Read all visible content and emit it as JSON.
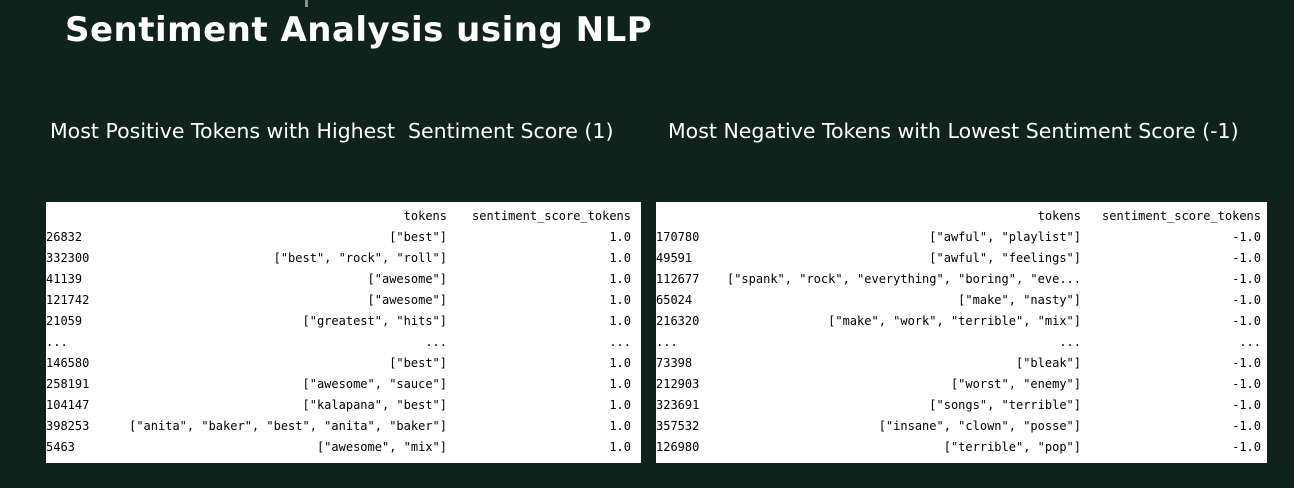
{
  "title": "Sentiment Analysis using NLP",
  "positive_panel": {
    "heading": "Most Positive Tokens with Highest  Sentiment Score (1)",
    "columns": [
      "tokens",
      "sentiment_score_tokens"
    ],
    "rows": [
      {
        "index": "26832",
        "tokens": "[\"best\"]",
        "score": "1.0"
      },
      {
        "index": "332300",
        "tokens": "[\"best\", \"rock\", \"roll\"]",
        "score": "1.0"
      },
      {
        "index": "41139",
        "tokens": "[\"awesome\"]",
        "score": "1.0"
      },
      {
        "index": "121742",
        "tokens": "[\"awesome\"]",
        "score": "1.0"
      },
      {
        "index": "21059",
        "tokens": "[\"greatest\", \"hits\"]",
        "score": "1.0"
      },
      {
        "index": "...",
        "tokens": "...",
        "score": "..."
      },
      {
        "index": "146580",
        "tokens": "[\"best\"]",
        "score": "1.0"
      },
      {
        "index": "258191",
        "tokens": "[\"awesome\", \"sauce\"]",
        "score": "1.0"
      },
      {
        "index": "104147",
        "tokens": "[\"kalapana\", \"best\"]",
        "score": "1.0"
      },
      {
        "index": "398253",
        "tokens": "[\"anita\", \"baker\", \"best\", \"anita\", \"baker\"]",
        "score": "1.0"
      },
      {
        "index": "5463",
        "tokens": "[\"awesome\", \"mix\"]",
        "score": "1.0"
      }
    ]
  },
  "negative_panel": {
    "heading": "Most Negative Tokens with Lowest Sentiment Score (-1)",
    "columns": [
      "tokens",
      "sentiment_score_tokens"
    ],
    "rows": [
      {
        "index": "170780",
        "tokens": "[\"awful\", \"playlist\"]",
        "score": "-1.0"
      },
      {
        "index": "49591",
        "tokens": "[\"awful\", \"feelings\"]",
        "score": "-1.0"
      },
      {
        "index": "112677",
        "tokens": "[\"spank\", \"rock\", \"everything\", \"boring\", \"eve...",
        "score": "-1.0"
      },
      {
        "index": "65024",
        "tokens": "[\"make\", \"nasty\"]",
        "score": "-1.0"
      },
      {
        "index": "216320",
        "tokens": "[\"make\", \"work\", \"terrible\", \"mix\"]",
        "score": "-1.0"
      },
      {
        "index": "...",
        "tokens": "...",
        "score": "..."
      },
      {
        "index": "73398",
        "tokens": "[\"bleak\"]",
        "score": "-1.0"
      },
      {
        "index": "212903",
        "tokens": "[\"worst\", \"enemy\"]",
        "score": "-1.0"
      },
      {
        "index": "323691",
        "tokens": "[\"songs\", \"terrible\"]",
        "score": "-1.0"
      },
      {
        "index": "357532",
        "tokens": "[\"insane\", \"clown\", \"posse\"]",
        "score": "-1.0"
      },
      {
        "index": "126980",
        "tokens": "[\"terrible\", \"pop\"]",
        "score": "-1.0"
      }
    ]
  },
  "colors": {
    "background": "#0f231c",
    "text": "#ffffff",
    "panel": "#ffffff"
  }
}
